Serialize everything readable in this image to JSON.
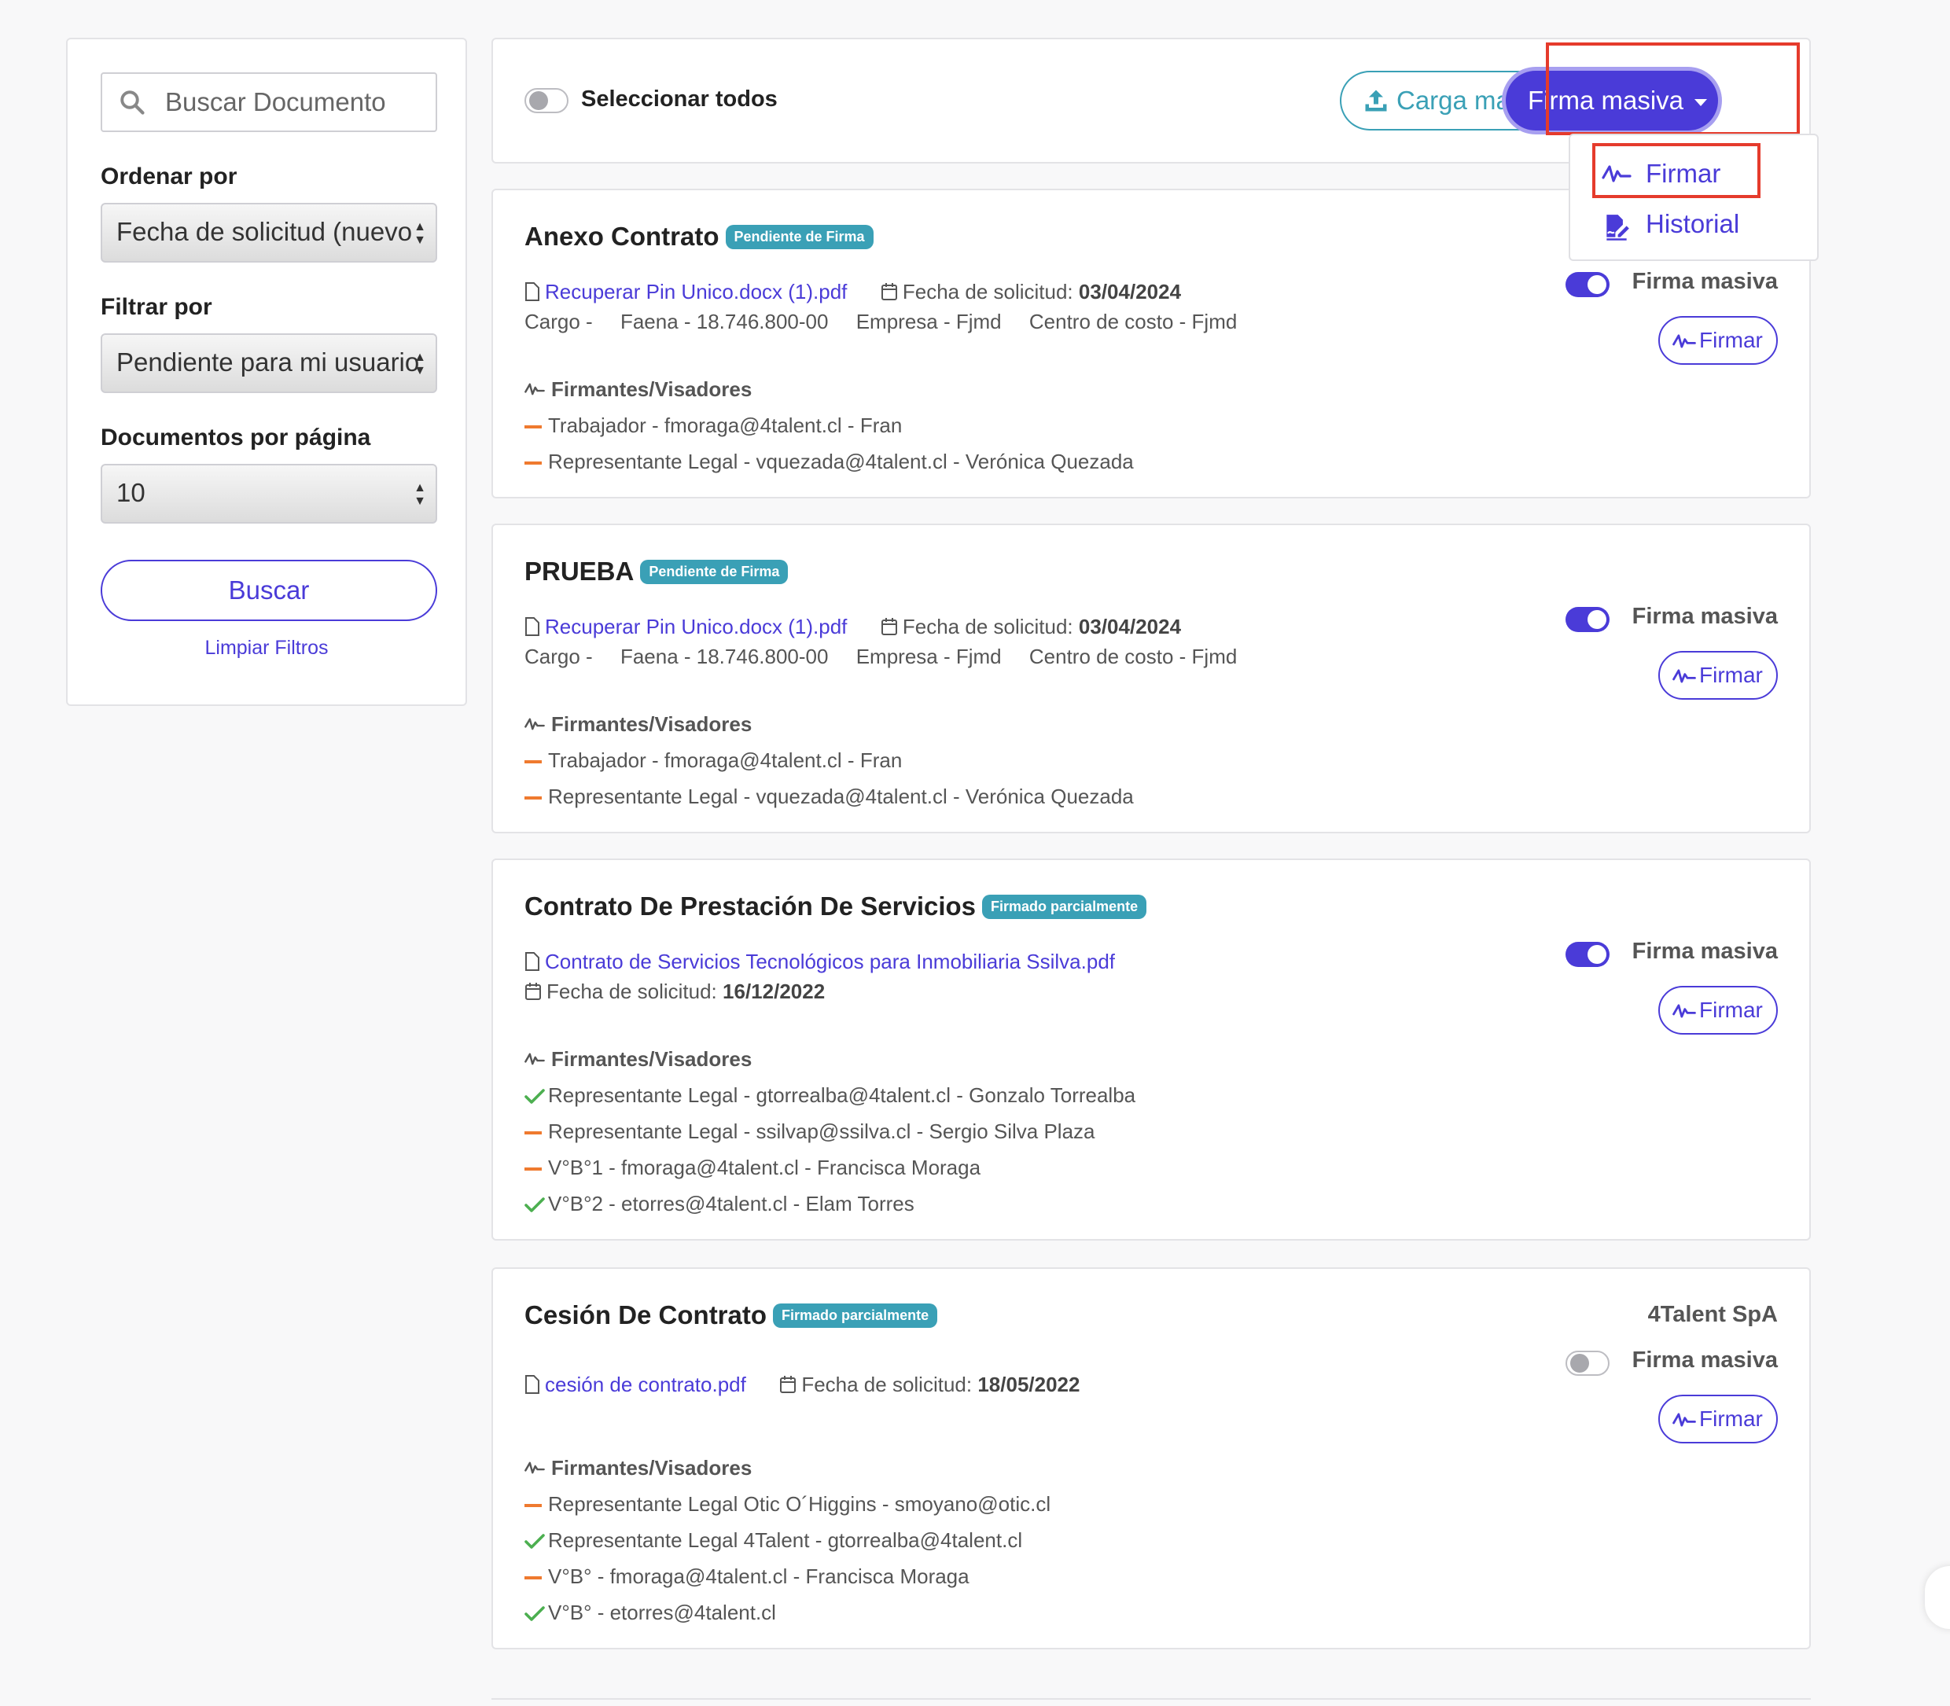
{
  "sidebar": {
    "search_placeholder": "Buscar Documento",
    "order_label": "Ordenar por",
    "order_value": "Fecha de solicitud (nuevo",
    "filter_label": "Filtrar por",
    "filter_value": "Pendiente para mi usuario",
    "per_page_label": "Documentos por página",
    "per_page_value": "10",
    "search_button": "Buscar",
    "clear_link": "Limpiar Filtros"
  },
  "topbar": {
    "select_all_label": "Seleccionar todos",
    "select_all_on": false,
    "bulk_upload_button": "Carga masiva",
    "bulk_sign_button": "Firma masiva"
  },
  "dropdown": {
    "items": [
      {
        "label": "Firmar",
        "icon": "signature-icon",
        "highlighted": true
      },
      {
        "label": "Historial",
        "icon": "file-signature-icon",
        "highlighted": false
      }
    ]
  },
  "common": {
    "signers_heading": "Firmantes/Visadores",
    "firma_masiva_label": "Firma masiva",
    "firmar_button": "Firmar",
    "request_date_label": "Fecha de solicitud:"
  },
  "documents": [
    {
      "title": "Anexo Contrato",
      "status": "Pendiente de Firma",
      "file": "Recuperar Pin Unico.docx (1).pdf",
      "request_date": "03/04/2024",
      "cargo": "Cargo -",
      "faena": "Faena - 18.746.800-00",
      "empresa": "Empresa - Fjmd",
      "centro": "Centro de costo - Fjmd",
      "firma_masiva_on": true,
      "signers": [
        {
          "status": "pending",
          "text": "Trabajador - fmoraga@4talent.cl - Fran"
        },
        {
          "status": "pending",
          "text": "Representante Legal - vquezada@4talent.cl - Verónica Quezada"
        }
      ]
    },
    {
      "title": "PRUEBA",
      "status": "Pendiente de Firma",
      "file": "Recuperar Pin Unico.docx (1).pdf",
      "request_date": "03/04/2024",
      "cargo": "Cargo -",
      "faena": "Faena - 18.746.800-00",
      "empresa": "Empresa - Fjmd",
      "centro": "Centro de costo - Fjmd",
      "firma_masiva_on": true,
      "signers": [
        {
          "status": "pending",
          "text": "Trabajador - fmoraga@4talent.cl - Fran"
        },
        {
          "status": "pending",
          "text": "Representante Legal - vquezada@4talent.cl - Verónica Quezada"
        }
      ]
    },
    {
      "title": "Contrato De Prestación De Servicios",
      "status": "Firmado parcialmente",
      "file": "Contrato de Servicios Tecnológicos para Inmobiliaria Ssilva.pdf",
      "request_date": "16/12/2022",
      "firma_masiva_on": true,
      "signers": [
        {
          "status": "signed",
          "text": "Representante Legal - gtorrealba@4talent.cl - Gonzalo Torrealba"
        },
        {
          "status": "pending",
          "text": "Representante Legal - ssilvap@ssilva.cl - Sergio Silva Plaza"
        },
        {
          "status": "pending",
          "text": "V°B°1 - fmoraga@4talent.cl - Francisca Moraga"
        },
        {
          "status": "signed",
          "text": "V°B°2 - etorres@4talent.cl - Elam Torres"
        }
      ]
    },
    {
      "title": "Cesión De Contrato",
      "status": "Firmado parcialmente",
      "company": "4Talent SpA",
      "file": "cesión de contrato.pdf",
      "request_date": "18/05/2022",
      "firma_masiva_on": false,
      "signers": [
        {
          "status": "pending",
          "text": "Representante Legal Otic O´Higgins - smoyano@otic.cl"
        },
        {
          "status": "signed",
          "text": "Representante Legal 4Talent - gtorrealba@4talent.cl"
        },
        {
          "status": "pending",
          "text": "V°B° - fmoraga@4talent.cl - Francisca Moraga"
        },
        {
          "status": "signed",
          "text": "V°B° - etorres@4talent.cl"
        }
      ]
    }
  ],
  "colors": {
    "primary": "#4a3bd8",
    "teal": "#3aa0b6",
    "pending": "#ef7a2f",
    "signed": "#4caf50",
    "highlight": "#e53b2c"
  }
}
